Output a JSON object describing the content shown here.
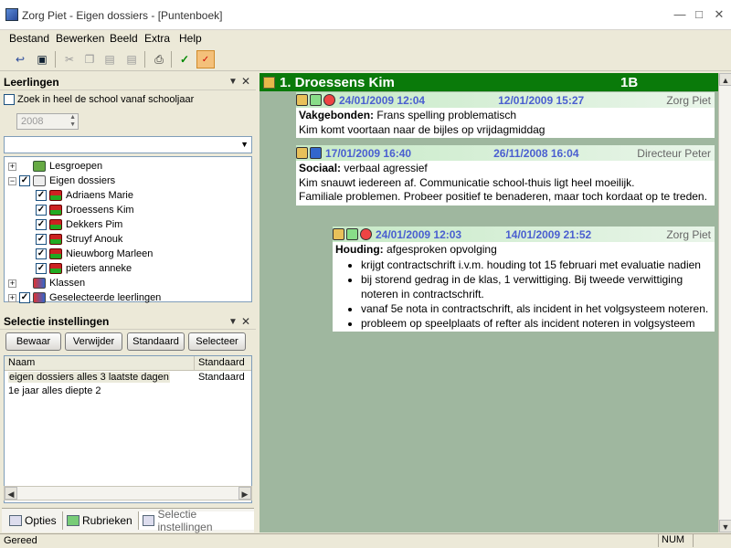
{
  "window": {
    "title": "Zorg Piet - Eigen dossiers - [Puntenboek]"
  },
  "menu": [
    "Bestand",
    "Bewerken",
    "Beeld",
    "Extra",
    "Help"
  ],
  "leerlingen": {
    "title": "Leerlingen",
    "search_label": "Zoek in heel de school vanaf schooljaar",
    "year": "2008",
    "tree": {
      "lesgroepen": "Lesgroepen",
      "eigen_dossiers": "Eigen dossiers",
      "students": [
        "Adriaens Marie",
        "Droessens Kim",
        "Dekkers Pim",
        "Struyf Anouk",
        "Nieuwborg Marleen",
        "pieters anneke"
      ],
      "klassen": "Klassen",
      "geselecteerde": "Geselecteerde leerlingen"
    }
  },
  "selectie": {
    "title": "Selectie instellingen",
    "buttons": [
      "Bewaar",
      "Verwijder",
      "Standaard",
      "Selecteer"
    ],
    "headers": [
      "Naam",
      "Standaard"
    ],
    "rows": [
      {
        "naam": "eigen dossiers alles 3 laatste dagen",
        "standaard": "Standaard"
      },
      {
        "naam": "1e jaar alles diepte 2",
        "standaard": ""
      }
    ]
  },
  "bottom_tabs": [
    "Opties",
    "Rubrieken",
    "Selectie instellingen"
  ],
  "dossier": {
    "student": "1. Droessens Kim",
    "klas": "1B",
    "entries": [
      {
        "date1": "24/01/2009 12:04",
        "date2": "12/01/2009 15:27",
        "author": "Zorg Piet",
        "category": "Vakgebonden:",
        "summary": "Frans spelling problematisch",
        "body": [
          "Kim komt voortaan naar de bijles op vrijdagmiddag"
        ]
      },
      {
        "date1": "17/01/2009 16:40",
        "date2": "26/11/2008 16:04",
        "author": "Directeur Peter",
        "category": "Sociaal:",
        "summary": "verbaal agressief",
        "body": [
          "Kim snauwt iedereen af. Communicatie school-thuis ligt heel moeilijk.",
          "Familiale problemen. Probeer positief te benaderen, maar toch kordaat op te treden."
        ]
      },
      {
        "date1": "24/01/2009 12:03",
        "date2": "14/01/2009 21:52",
        "author": "Zorg Piet",
        "category": "Houding:",
        "summary": "afgesproken opvolging",
        "bullets": [
          "krijgt contractschrift i.v.m. houding tot 15 februari met evaluatie nadien",
          "bij storend gedrag in de klas, 1 verwittiging. Bij tweede verwittiging noteren in contractschrift.",
          "vanaf 5e nota in contractschrift, als incident in het volgsysteem noteren.",
          "probleem op speelplaats of refter als incident noteren in volgsysteem"
        ]
      }
    ]
  },
  "status": {
    "left": "Gereed",
    "num": "NUM"
  }
}
